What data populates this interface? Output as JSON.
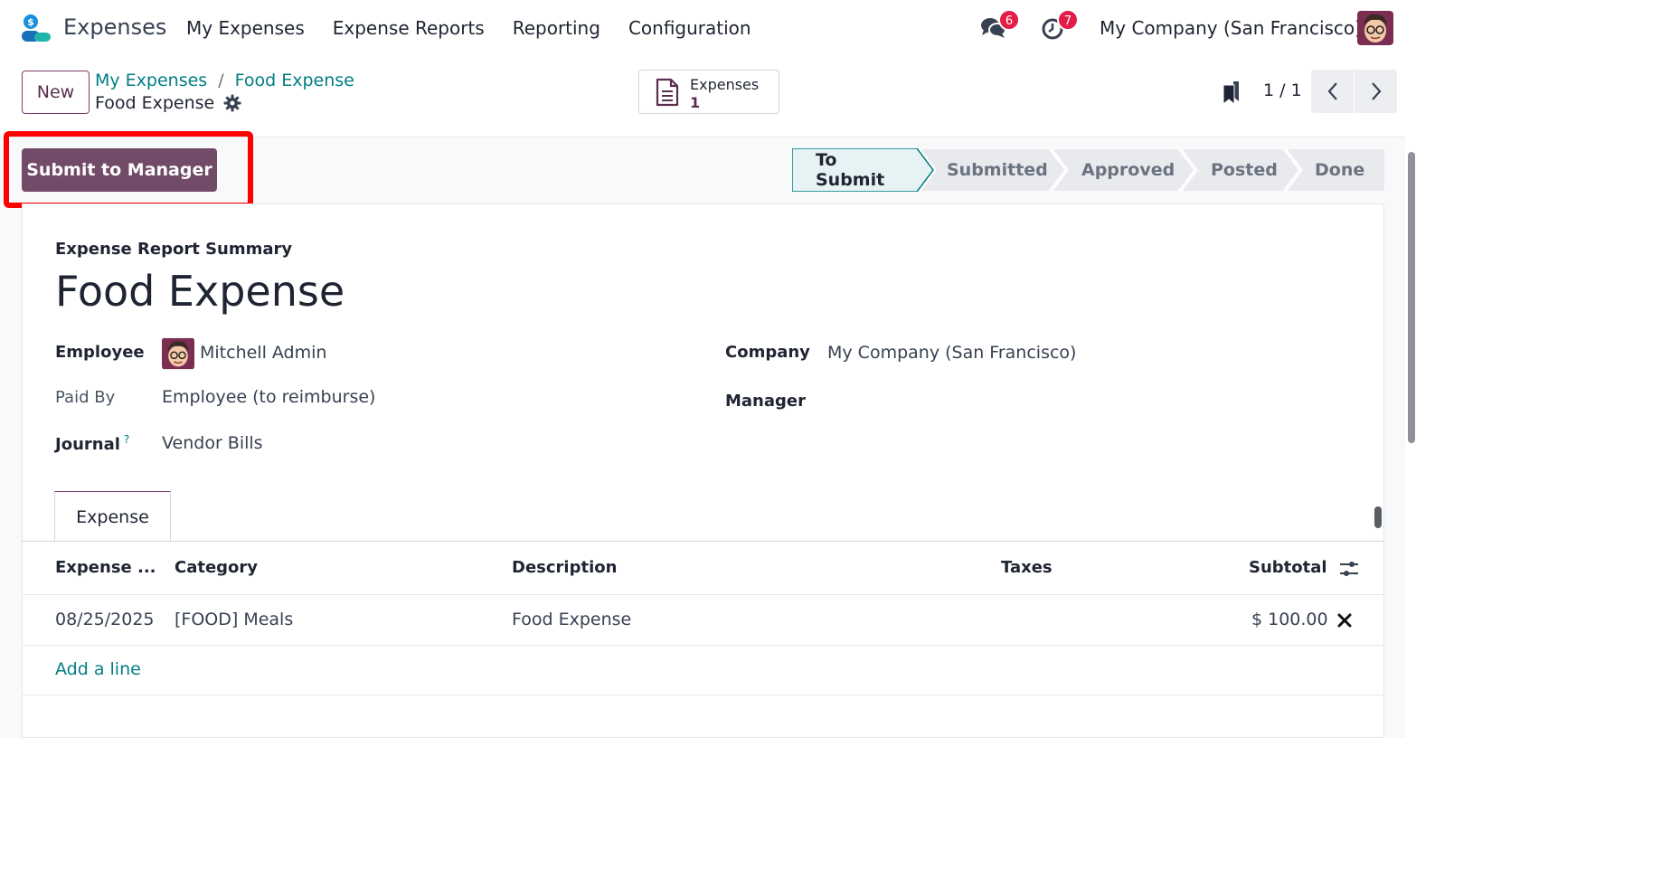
{
  "app": {
    "name": "Expenses"
  },
  "nav": {
    "menu": [
      "My Expenses",
      "Expense Reports",
      "Reporting",
      "Configuration"
    ],
    "chat_count": "6",
    "activity_count": "7",
    "company": "My Company (San Francisco)"
  },
  "control": {
    "new_label": "New",
    "breadcrumb": [
      "My Expenses",
      "Food Expense"
    ],
    "breadcrumb_sep": "/",
    "current": "Food Expense",
    "smart_button": {
      "label": "Expenses",
      "value": "1"
    },
    "pager": "1 / 1"
  },
  "actions": {
    "submit_label": "Submit to Manager"
  },
  "statusbar": {
    "stages": [
      "To Submit",
      "Submitted",
      "Approved",
      "Posted",
      "Done"
    ],
    "active": "To Submit"
  },
  "form": {
    "summary_label": "Expense Report Summary",
    "title": "Food Expense",
    "employee_label": "Employee",
    "employee_value": "Mitchell Admin",
    "paid_by_label": "Paid By",
    "paid_by_value": "Employee (to reimburse)",
    "journal_label": "Journal",
    "journal_help": "?",
    "journal_value": "Vendor Bills",
    "company_label": "Company",
    "company_value": "My Company (San Francisco)",
    "manager_label": "Manager"
  },
  "tabs": [
    "Expense"
  ],
  "table": {
    "headers": [
      "Expense ...",
      "Category",
      "Description",
      "Taxes",
      "Subtotal"
    ],
    "rows": [
      {
        "date": "08/25/2025",
        "category": "[FOOD] Meals",
        "description": "Food Expense",
        "taxes": "",
        "subtotal": "$ 100.00"
      }
    ],
    "add_line": "Add a line"
  },
  "colors": {
    "primary": "#714b67",
    "link": "#017e84",
    "badge": "#e11d48",
    "highlight": "#ff0000"
  }
}
